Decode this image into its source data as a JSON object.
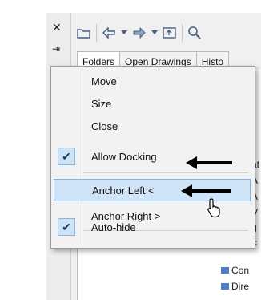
{
  "palette": {
    "close_glyph": "✕",
    "pin_glyph": "⇥",
    "toolbar_icons": [
      "folder-open-icon",
      "back-icon",
      "dropdown-icon",
      "forward-icon",
      "dropdown-icon",
      "up-folder-icon",
      "search-icon"
    ],
    "tabs": [
      {
        "label": "Folders",
        "active": true
      },
      {
        "label": "Open Drawings",
        "active": false
      },
      {
        "label": "Histo",
        "active": false
      }
    ],
    "tree_fragments": [
      "at",
      "A",
      "A",
      "V",
      "d",
      "F"
    ],
    "tree_items": [
      "Con",
      "Dire"
    ]
  },
  "context_menu": {
    "items": [
      {
        "label": "Move",
        "checked": false,
        "highlighted": false
      },
      {
        "label": "Size",
        "checked": false,
        "highlighted": false
      },
      {
        "label": "Close",
        "checked": false,
        "highlighted": false
      },
      {
        "label": "Allow Docking",
        "checked": true,
        "highlighted": false
      },
      {
        "label": "Anchor Left <",
        "checked": false,
        "highlighted": true
      },
      {
        "label": "Anchor Right >",
        "checked": false,
        "highlighted": false
      },
      {
        "label": "Auto-hide",
        "checked": true,
        "highlighted": false
      }
    ],
    "check_glyph": "✔"
  },
  "colors": {
    "highlight": "#cfe4f7",
    "highlight_border": "#7eb4ea",
    "annotation_arrow": "#000000"
  }
}
